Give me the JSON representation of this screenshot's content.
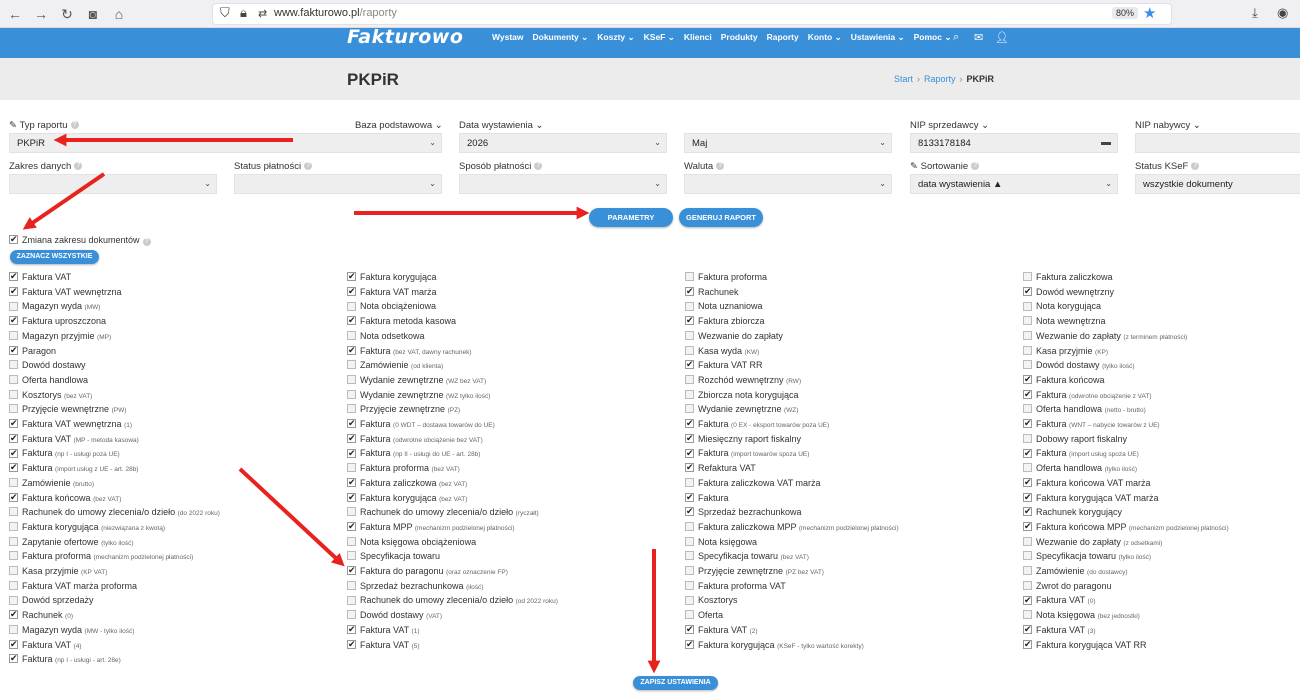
{
  "browser": {
    "url_host": "www.fakturowo.pl",
    "url_path": "/raporty",
    "zoom": "80%"
  },
  "nav": {
    "logo": "Fakturowo",
    "menu": [
      "Wystaw",
      "Dokumenty ⌄",
      "Koszty ⌄",
      "KSeF ⌄",
      "Klienci",
      "Produkty",
      "Raporty",
      "Konto ⌄",
      "Ustawienia ⌄",
      "Pomoc ⌄"
    ]
  },
  "page": {
    "title": "PKPiR",
    "breadcrumb": [
      "Start",
      "Raporty",
      "PKPiR"
    ]
  },
  "filters": {
    "typ_raportu": {
      "label": "Typ raportu",
      "value": "PKPiR"
    },
    "baza": {
      "label": "Baza podstawowa ⌄"
    },
    "data_wystawienia": {
      "label": "Data wystawienia ⌄",
      "year": "2026",
      "month": "Maj"
    },
    "nip_sprzedawcy": {
      "label": "NIP sprzedawcy ⌄",
      "value": "8133178184"
    },
    "nip_nabywcy": {
      "label": "NIP nabywcy ⌄"
    },
    "zakres_danych": {
      "label": "Zakres danych"
    },
    "status_platnosci": {
      "label": "Status płatności"
    },
    "sposob_platnosci": {
      "label": "Sposób płatności"
    },
    "waluta": {
      "label": "Waluta"
    },
    "sortowanie": {
      "label": "Sortowanie",
      "value": "data wystawienia ▲"
    },
    "status_ksef": {
      "label": "Status KSeF",
      "value": "wszystkie dokumenty"
    }
  },
  "buttons": {
    "parametry": "PARAMETRY",
    "generuj": "GENERUJ RAPORT",
    "zaznacz": "ZAZNACZ WSZYSTKIE",
    "zapisz": "ZAPISZ USTAWIENIA"
  },
  "zmiana": {
    "label": "Zmiana zakresu dokumentów",
    "checked": true
  },
  "columns": [
    [
      {
        "t": "Faktura VAT",
        "s": "",
        "c": true
      },
      {
        "t": "Faktura VAT wewnętrzna",
        "s": "",
        "c": true
      },
      {
        "t": "Magazyn wyda",
        "s": "(MW)",
        "c": false
      },
      {
        "t": "Faktura uproszczona",
        "s": "",
        "c": true
      },
      {
        "t": "Magazyn przyjmie",
        "s": "(MP)",
        "c": false
      },
      {
        "t": "Paragon",
        "s": "",
        "c": true
      },
      {
        "t": "Dowód dostawy",
        "s": "",
        "c": false
      },
      {
        "t": "Oferta handlowa",
        "s": "",
        "c": false
      },
      {
        "t": "Kosztorys",
        "s": "(bez VAT)",
        "c": false
      },
      {
        "t": "Przyjęcie wewnętrzne",
        "s": "(PW)",
        "c": false
      },
      {
        "t": "Faktura VAT wewnętrzna",
        "s": "(1)",
        "c": true
      },
      {
        "t": "Faktura VAT",
        "s": "(MP - metoda kasowa)",
        "c": true
      },
      {
        "t": "Faktura",
        "s": "(np I - usługi poza UE)",
        "c": true
      },
      {
        "t": "Faktura",
        "s": "(import usług z UE - art. 28b)",
        "c": true
      },
      {
        "t": "Zamówienie",
        "s": "(brutto)",
        "c": false
      },
      {
        "t": "Faktura końcowa",
        "s": "(bez VAT)",
        "c": true
      },
      {
        "t": "Rachunek do umowy zlecenia/o dzieło",
        "s": "(do 2022 roku)",
        "c": false
      },
      {
        "t": "Faktura korygująca",
        "s": "(niezwiązana z kwotą)",
        "c": false
      },
      {
        "t": "Zapytanie ofertowe",
        "s": "(tylko ilość)",
        "c": false
      },
      {
        "t": "Faktura proforma",
        "s": "(mechanizm podzielonej płatności)",
        "c": false
      },
      {
        "t": "Kasa przyjmie",
        "s": "(KP VAT)",
        "c": false
      },
      {
        "t": "Faktura VAT marża proforma",
        "s": "",
        "c": false
      },
      {
        "t": "Dowód sprzedaży",
        "s": "",
        "c": false
      },
      {
        "t": "Rachunek",
        "s": "(0)",
        "c": true
      },
      {
        "t": "Magazyn wyda",
        "s": "(MW - tylko ilość)",
        "c": false
      },
      {
        "t": "Faktura VAT",
        "s": "(4)",
        "c": true
      },
      {
        "t": "Faktura",
        "s": "(np I - usługi - art. 28e)",
        "c": true
      }
    ],
    [
      {
        "t": "Faktura korygująca",
        "s": "",
        "c": true
      },
      {
        "t": "Faktura VAT marża",
        "s": "",
        "c": true
      },
      {
        "t": "Nota obciążeniowa",
        "s": "",
        "c": false
      },
      {
        "t": "Faktura metoda kasowa",
        "s": "",
        "c": true
      },
      {
        "t": "Nota odsetkowa",
        "s": "",
        "c": false
      },
      {
        "t": "Faktura",
        "s": "(bez VAT, dawny rachunek)",
        "c": true
      },
      {
        "t": "Zamówienie",
        "s": "(od klienta)",
        "c": false
      },
      {
        "t": "Wydanie zewnętrzne",
        "s": "(WZ bez VAT)",
        "c": false
      },
      {
        "t": "Wydanie zewnętrzne",
        "s": "(WZ tylko ilość)",
        "c": false
      },
      {
        "t": "Przyjęcie zewnętrzne",
        "s": "(PZ)",
        "c": false
      },
      {
        "t": "Faktura",
        "s": "(0 WDT – dostawa towarów do UE)",
        "c": true
      },
      {
        "t": "Faktura",
        "s": "(odwrotne obciążenie bez VAT)",
        "c": true
      },
      {
        "t": "Faktura",
        "s": "(np II - usługi do UE - art. 28b)",
        "c": true
      },
      {
        "t": "Faktura proforma",
        "s": "(bez VAT)",
        "c": false
      },
      {
        "t": "Faktura zaliczkowa",
        "s": "(bez VAT)",
        "c": true
      },
      {
        "t": "Faktura korygująca",
        "s": "(bez VAT)",
        "c": true
      },
      {
        "t": "Rachunek do umowy zlecenia/o dzieło",
        "s": "(ryczałt)",
        "c": false
      },
      {
        "t": "Faktura MPP",
        "s": "(mechanizm podzielonej płatności)",
        "c": true
      },
      {
        "t": "Nota księgowa obciążeniowa",
        "s": "",
        "c": false
      },
      {
        "t": "Specyfikacja towaru",
        "s": "",
        "c": false
      },
      {
        "t": "Faktura do paragonu",
        "s": "(oraz oznaczenie FP)",
        "c": true
      },
      {
        "t": "Sprzedaż bezrachunkowa",
        "s": "(ilość)",
        "c": false
      },
      {
        "t": "Rachunek do umowy zlecenia/o dzieło",
        "s": "(od 2022 roku)",
        "c": false
      },
      {
        "t": "Dowód dostawy",
        "s": "(VAT)",
        "c": false
      },
      {
        "t": "Faktura VAT",
        "s": "(1)",
        "c": true
      },
      {
        "t": "Faktura VAT",
        "s": "(5)",
        "c": true
      }
    ],
    [
      {
        "t": "Faktura proforma",
        "s": "",
        "c": false
      },
      {
        "t": "Rachunek",
        "s": "",
        "c": true
      },
      {
        "t": "Nota uznaniowa",
        "s": "",
        "c": false
      },
      {
        "t": "Faktura zbiorcza",
        "s": "",
        "c": true
      },
      {
        "t": "Wezwanie do zapłaty",
        "s": "",
        "c": false
      },
      {
        "t": "Kasa wyda",
        "s": "(KW)",
        "c": false
      },
      {
        "t": "Faktura VAT RR",
        "s": "",
        "c": true
      },
      {
        "t": "Rozchód wewnętrzny",
        "s": "(RW)",
        "c": false
      },
      {
        "t": "Zbiorcza nota korygująca",
        "s": "",
        "c": false
      },
      {
        "t": "Wydanie zewnętrzne",
        "s": "(WZ)",
        "c": false
      },
      {
        "t": "Faktura",
        "s": "(0 EX - eksport towarów poza UE)",
        "c": true
      },
      {
        "t": "Miesięczny raport fiskalny",
        "s": "",
        "c": true
      },
      {
        "t": "Faktura",
        "s": "(import towarów spoza UE)",
        "c": true
      },
      {
        "t": "Refaktura VAT",
        "s": "",
        "c": true
      },
      {
        "t": "Faktura zaliczkowa VAT marża",
        "s": "",
        "c": false
      },
      {
        "t": "Faktura",
        "s": "",
        "c": true
      },
      {
        "t": "Sprzedaż bezrachunkowa",
        "s": "",
        "c": true
      },
      {
        "t": "Faktura zaliczkowa MPP",
        "s": "(mechanizm podzielonej płatności)",
        "c": false
      },
      {
        "t": "Nota księgowa",
        "s": "",
        "c": false
      },
      {
        "t": "Specyfikacja towaru",
        "s": "(bez VAT)",
        "c": false
      },
      {
        "t": "Przyjęcie zewnętrzne",
        "s": "(PZ bez VAT)",
        "c": false
      },
      {
        "t": "Faktura proforma VAT",
        "s": "",
        "c": false
      },
      {
        "t": "Kosztorys",
        "s": "",
        "c": false
      },
      {
        "t": "Oferta",
        "s": "",
        "c": false
      },
      {
        "t": "Faktura VAT",
        "s": "(2)",
        "c": true
      },
      {
        "t": "Faktura korygująca",
        "s": "(KSeF - tylko wartość korekty)",
        "c": true
      }
    ],
    [
      {
        "t": "Faktura zaliczkowa",
        "s": "",
        "c": false
      },
      {
        "t": "Dowód wewnętrzny",
        "s": "",
        "c": true
      },
      {
        "t": "Nota korygująca",
        "s": "",
        "c": false
      },
      {
        "t": "Nota wewnętrzna",
        "s": "",
        "c": false
      },
      {
        "t": "Wezwanie do zapłaty",
        "s": "(z terminem płatności)",
        "c": false
      },
      {
        "t": "Kasa przyjmie",
        "s": "(KP)",
        "c": false
      },
      {
        "t": "Dowód dostawy",
        "s": "(tylko ilość)",
        "c": false
      },
      {
        "t": "Faktura końcowa",
        "s": "",
        "c": true
      },
      {
        "t": "Faktura",
        "s": "(odwrotne obciążenie z VAT)",
        "c": true
      },
      {
        "t": "Oferta handlowa",
        "s": "(netto - brutto)",
        "c": false
      },
      {
        "t": "Faktura",
        "s": "(WNT – nabycie towarów z UE)",
        "c": true
      },
      {
        "t": "Dobowy raport fiskalny",
        "s": "",
        "c": false
      },
      {
        "t": "Faktura",
        "s": "(import usług spoza UE)",
        "c": true
      },
      {
        "t": "Oferta handlowa",
        "s": "(tylko ilość)",
        "c": false
      },
      {
        "t": "Faktura końcowa VAT marża",
        "s": "",
        "c": true
      },
      {
        "t": "Faktura korygująca VAT marża",
        "s": "",
        "c": true
      },
      {
        "t": "Rachunek korygujący",
        "s": "",
        "c": true
      },
      {
        "t": "Faktura końcowa MPP",
        "s": "(mechanizm podzielonej płatności)",
        "c": true
      },
      {
        "t": "Wezwanie do zapłaty",
        "s": "(z odsetkami)",
        "c": false
      },
      {
        "t": "Specyfikacja towaru",
        "s": "(tylko ilość)",
        "c": false
      },
      {
        "t": "Zamówienie",
        "s": "(do dostawcy)",
        "c": false
      },
      {
        "t": "Zwrot do paragonu",
        "s": "",
        "c": false
      },
      {
        "t": "Faktura VAT",
        "s": "(0)",
        "c": true
      },
      {
        "t": "Nota księgowa",
        "s": "(bez jednostki)",
        "c": false
      },
      {
        "t": "Faktura VAT",
        "s": "(3)",
        "c": true
      },
      {
        "t": "Faktura korygująca VAT RR",
        "s": "",
        "c": true
      }
    ]
  ],
  "colors": {
    "primary": "#3a8fd9",
    "arrow": "#e8231f"
  }
}
